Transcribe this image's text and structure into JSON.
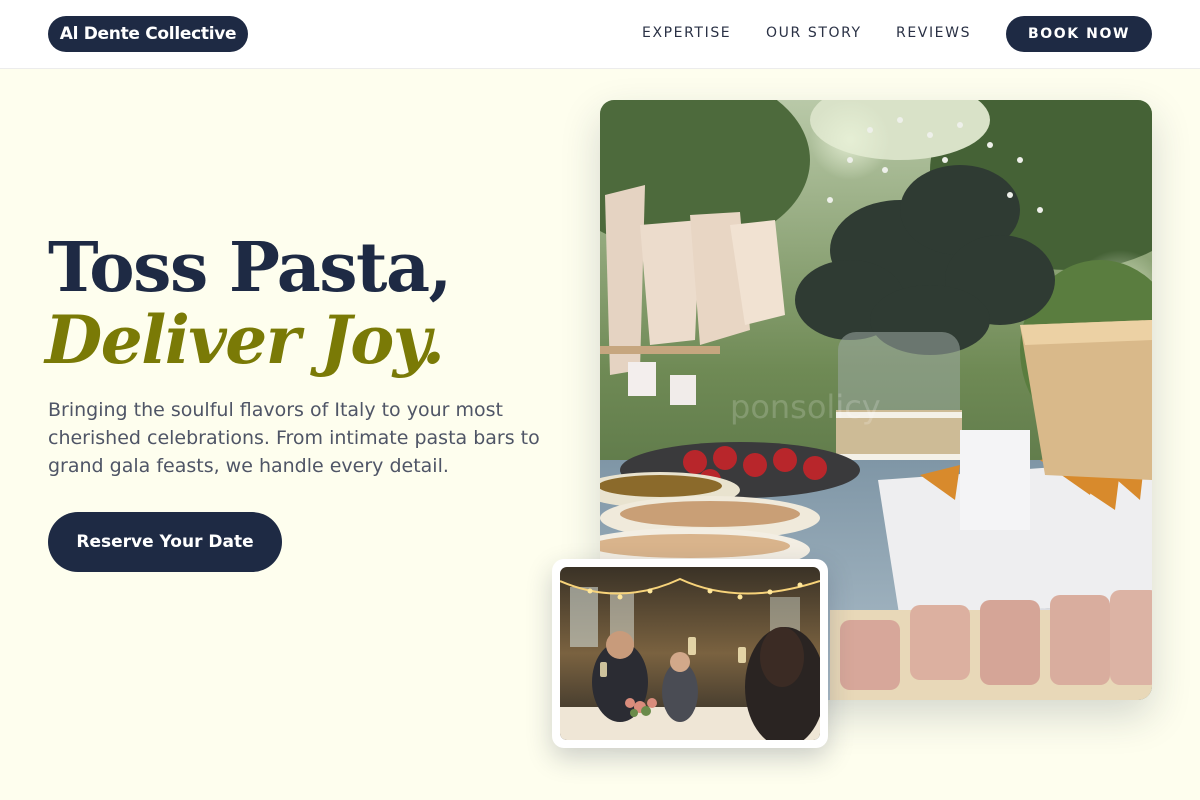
{
  "header": {
    "logo": "Al Dente Collective",
    "nav": [
      "EXPERTISE",
      "OUR STORY",
      "REVIEWS"
    ],
    "cta": "BOOK NOW"
  },
  "hero": {
    "headline_line1": "Toss Pasta,",
    "headline_line2": "Deliver Joy.",
    "subtext": "Bringing the soulful flavors of Italy to your most cherished celebrations. From intimate pasta bars to grand gala feasts, we handle every detail.",
    "cta": "Reserve Your Date"
  },
  "colors": {
    "navy": "#1e2a44",
    "olive_accent": "#7a7a06",
    "cream_background": "#FEFEEE",
    "body_text": "#4f5566"
  }
}
